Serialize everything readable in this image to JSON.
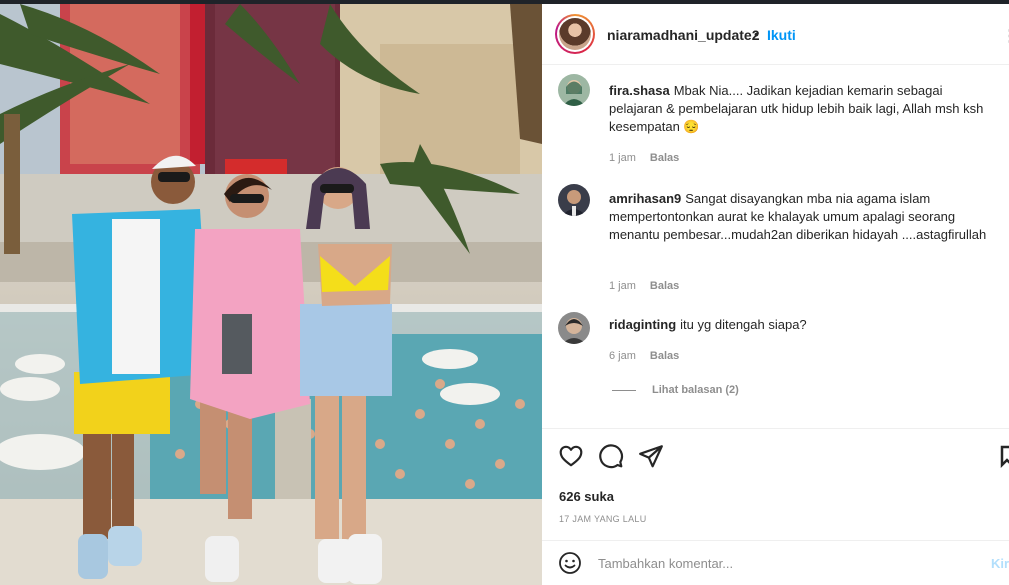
{
  "post": {
    "username": "niaramadhani_update2",
    "separator": "•",
    "follow_label": "Ikuti",
    "more_icon": "more-options-icon"
  },
  "comments": [
    {
      "username": "fira.shasa",
      "text": "Mbak Nia.... Jadikan kejadian kemarin sebagai pelajaran & pembelajaran utk hidup lebih baik lagi, Allah msh ksh kesempatan 😔",
      "time": "1 jam",
      "reply_label": "Balas"
    },
    {
      "username": "amrihasan9",
      "text": "Sangat disayangkan mba nia agama islam mempertontonkan aurat ke khalayak umum apalagi seorang menantu pembesar...mudah2an diberikan hidayah ....astagfirullah",
      "time": "1 jam",
      "reply_label": "Balas"
    },
    {
      "username": "ridaginting",
      "text": "itu yg ditengah siapa?",
      "time": "6 jam",
      "reply_label": "Balas"
    }
  ],
  "view_replies_label": "Lihat balasan (2)",
  "actions": {
    "like_icon": "heart-icon",
    "comment_icon": "comment-icon",
    "share_icon": "share-icon",
    "likes_text": "626 suka",
    "timestamp": "17 JAM YANG LALU"
  },
  "add_comment": {
    "placeholder": "Tambahkan komentar...",
    "post_label": "Kirim",
    "emoji_icon": "emoji-icon"
  },
  "colors": {
    "accent": "#0095f6",
    "muted": "#8e8e8e",
    "text": "#262626"
  }
}
